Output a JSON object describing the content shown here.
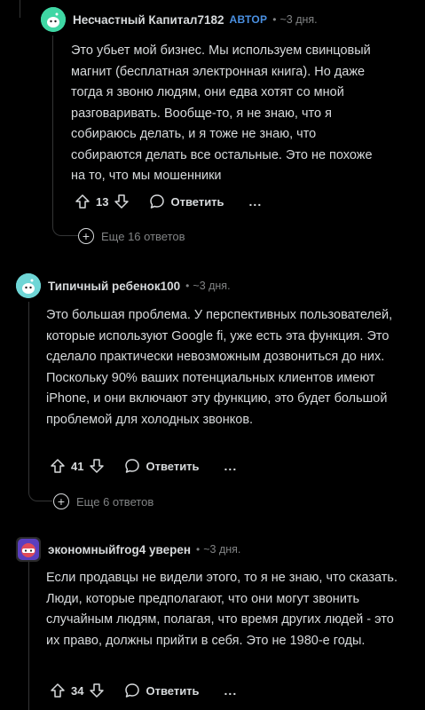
{
  "comments": [
    {
      "username": "Несчастный Капитал7182",
      "op_badge": "АВТОР",
      "time": "3 дня.",
      "body": "Это убьет мой бизнес. Мы используем свинцовый магнит (бесплатная электронная книга). Но даже тогда я звоню людям, они едва хотят со мной разговаривать. Вообще-то, я не знаю, что я собираюсь делать, и я тоже не знаю, что собираются делать все остальные. Это не похоже на то, что мы мошенники",
      "votes": "13",
      "reply_label": "Ответить",
      "more_label": "...",
      "more_replies": "Еще 16 ответов",
      "avatar_color": "#3fd7a4"
    },
    {
      "username": "Типичный ребенок100",
      "time": "3 дня.",
      "body": "Это большая проблема. У перспективных пользователей, которые используют Google fi, уже есть эта функция. Это сделало практически невозможным дозвониться до них. Поскольку 90% ваших потенциальных клиентов имеют iPhone, и они включают эту функцию, это будет большой проблемой для холодных звонков.",
      "votes": "41",
      "reply_label": "Ответить",
      "more_label": "...",
      "more_replies": "Еще 6 ответов",
      "avatar_color": "#6fd6d6"
    },
    {
      "username": "экономныйfrog4 уверен",
      "time": "3 дня.",
      "body": "Если продавцы не видели этого, то я не знаю, что сказать. Люди, которые предполагают, что они могут звонить случайным людям, полагая, что время других людей - это их право, должны прийти в себя. Это не 1980-е годы.",
      "votes": "34",
      "reply_label": "Ответить",
      "more_label": "...",
      "avatar_color": "#c43b4a"
    }
  ],
  "separator": "•",
  "time_prefix": "~"
}
